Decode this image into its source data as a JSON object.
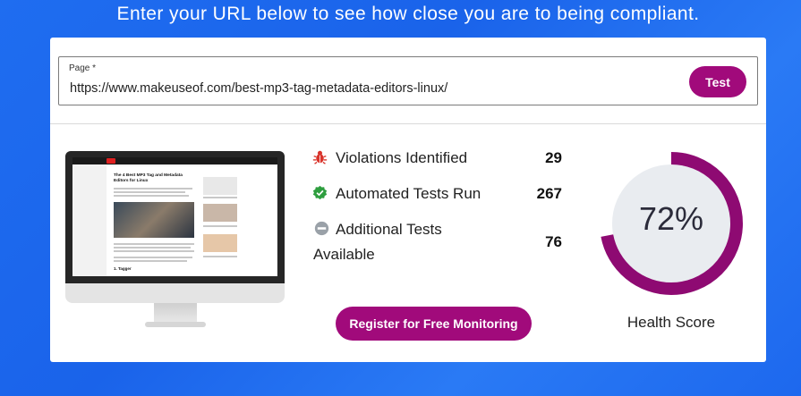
{
  "headline": "Enter your URL below to see how close you are to being compliant.",
  "url_form": {
    "label": "Page *",
    "value": "https://www.makeuseof.com/best-mp3-tag-metadata-editors-linux/",
    "test_label": "Test"
  },
  "preview": {
    "article_title": "The 4 Best MP3 Tag and Metadata Editors for Linux",
    "subheading": "1. Tagger"
  },
  "stats": [
    {
      "label": "Violations Identified",
      "value": "29",
      "icon": "bug-icon",
      "color": "#d9342b"
    },
    {
      "label": "Automated Tests Run",
      "value": "267",
      "icon": "check-badge-icon",
      "color": "#2e9e3f"
    },
    {
      "label_line1": "Additional Tests",
      "label_line2": "Available",
      "value": "76",
      "icon": "minus-circle-icon",
      "color": "#9aa1a8"
    }
  ],
  "register_label": "Register for Free Monitoring",
  "health": {
    "score_text": "72%",
    "score": 72,
    "label": "Health Score",
    "ring_color": "#8e0a72",
    "track_color": "#e9ecf0"
  }
}
